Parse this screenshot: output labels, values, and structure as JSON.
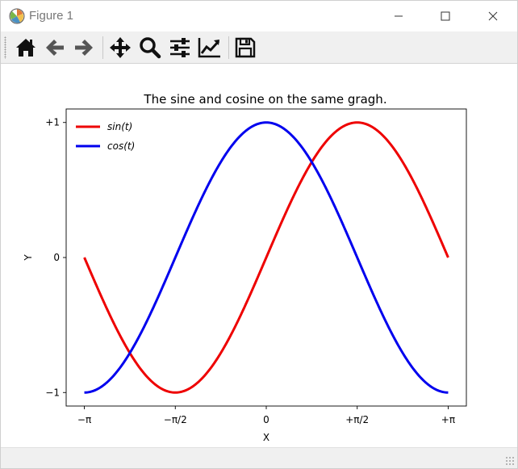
{
  "window": {
    "title": "Figure 1",
    "app_icon": "matplotlib-icon"
  },
  "window_controls": {
    "minimize_icon": "minimize-icon",
    "maximize_icon": "maximize-icon",
    "close_icon": "close-icon"
  },
  "toolbar": {
    "items": [
      {
        "name": "home-button",
        "icon": "home-icon"
      },
      {
        "name": "back-button",
        "icon": "arrow-left-icon"
      },
      {
        "name": "forward-button",
        "icon": "arrow-right-icon"
      },
      {
        "name": "pan-button",
        "icon": "move-icon"
      },
      {
        "name": "zoom-button",
        "icon": "magnifier-icon"
      },
      {
        "name": "configure-subplots-button",
        "icon": "sliders-icon"
      },
      {
        "name": "edit-axis-button",
        "icon": "chart-line-icon"
      },
      {
        "name": "save-button",
        "icon": "floppy-disk-icon"
      }
    ]
  },
  "chart_data": {
    "type": "line",
    "title": "The sine and cosine on the same gragh.",
    "xlabel": "X",
    "ylabel": "Y",
    "xlim": [
      -3.4558,
      3.4558
    ],
    "ylim": [
      -1.1,
      1.1
    ],
    "x_range": [
      -3.14159,
      3.14159
    ],
    "xticks": [
      -3.14159,
      -1.5708,
      0,
      1.5708,
      3.14159
    ],
    "xtick_labels": [
      "−π",
      "−π/2",
      "0",
      "+π/2",
      "+π"
    ],
    "yticks": [
      1,
      0,
      -1
    ],
    "ytick_labels": [
      "+1",
      "0",
      "−1"
    ],
    "grid": false,
    "legend_placement": "upper-left",
    "series": [
      {
        "name": "sin(t)",
        "function": "sin",
        "color": "#ee0000",
        "linewidth": 3
      },
      {
        "name": "cos(t)",
        "function": "cos",
        "color": "#0000ee",
        "linewidth": 3
      }
    ]
  },
  "statusbar": {
    "text": ""
  }
}
